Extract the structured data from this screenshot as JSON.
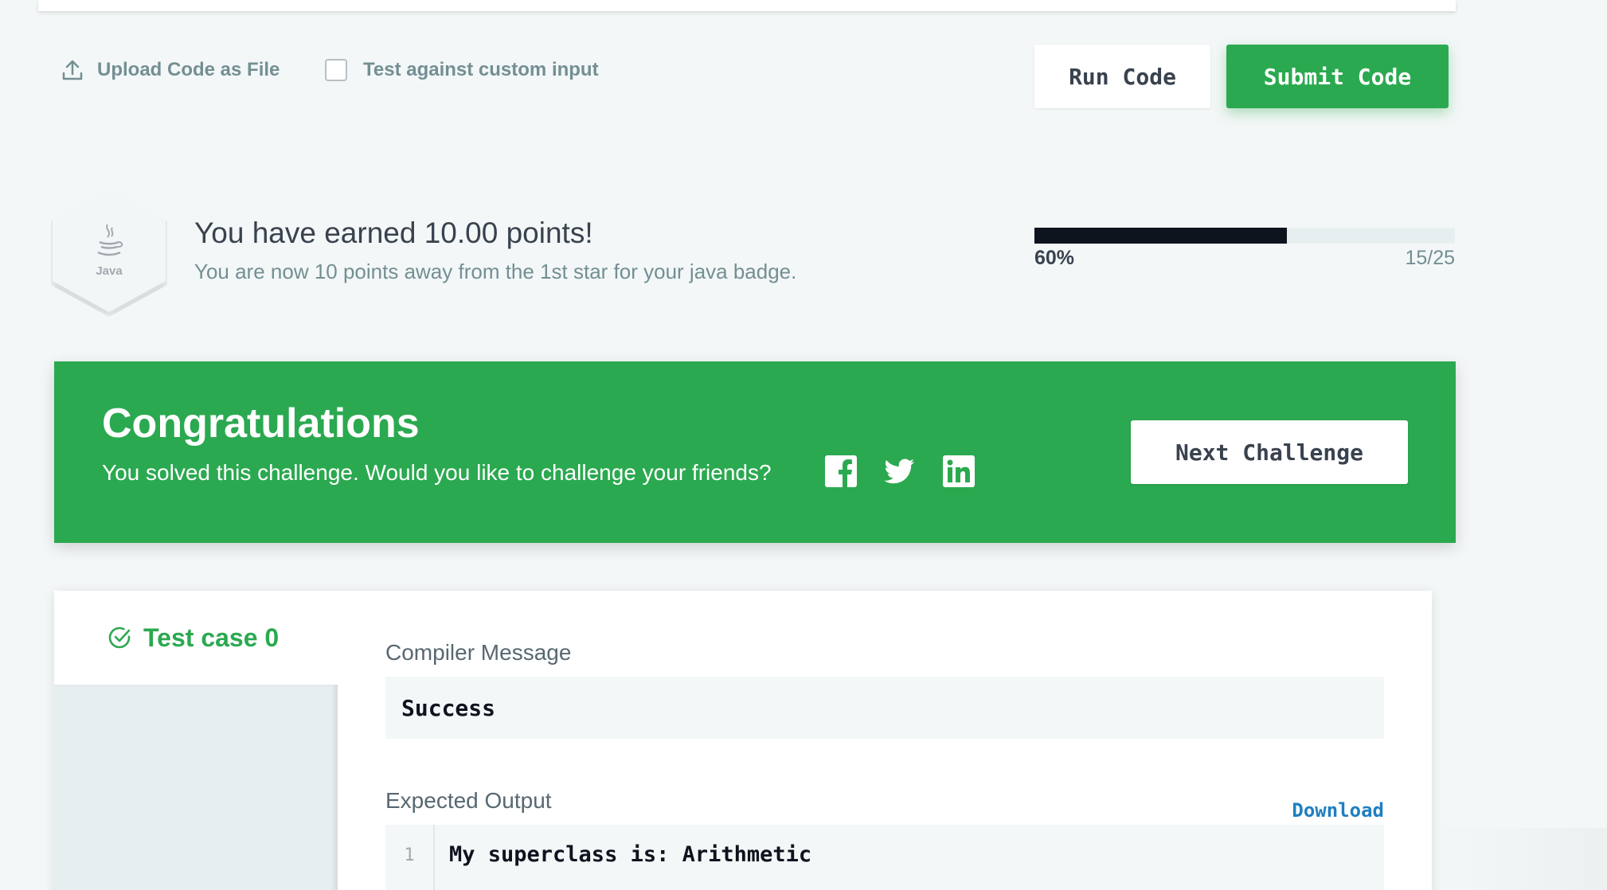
{
  "actions": {
    "upload_label": "Upload Code as File",
    "custom_input_label": "Test against custom input",
    "custom_input_checked": false,
    "run_label": "Run Code",
    "submit_label": "Submit Code"
  },
  "points": {
    "badge_label": "Java",
    "title": "You have earned 10.00 points!",
    "subtitle": "You are now 10 points away from the 1st star for your java badge.",
    "progress_percent_text": "60%",
    "progress_fraction": 0.6,
    "progress_count": "15/25"
  },
  "banner": {
    "title": "Congratulations",
    "text": "You solved this challenge. Would you like to challenge your friends?",
    "social": [
      "facebook-icon",
      "twitter-icon",
      "linkedin-icon"
    ],
    "next_label": "Next Challenge"
  },
  "results": {
    "tab_label": "Test case 0",
    "compiler_label": "Compiler Message",
    "compiler_value": "Success",
    "expected_label": "Expected Output",
    "download_label": "Download",
    "output_lines": [
      {
        "num": "1",
        "text": "My superclass is: Arithmetic"
      }
    ]
  },
  "colors": {
    "accent_green": "#2ba950",
    "dark": "#0e141e",
    "muted": "#738f93",
    "link_blue": "#1f7fc1"
  }
}
